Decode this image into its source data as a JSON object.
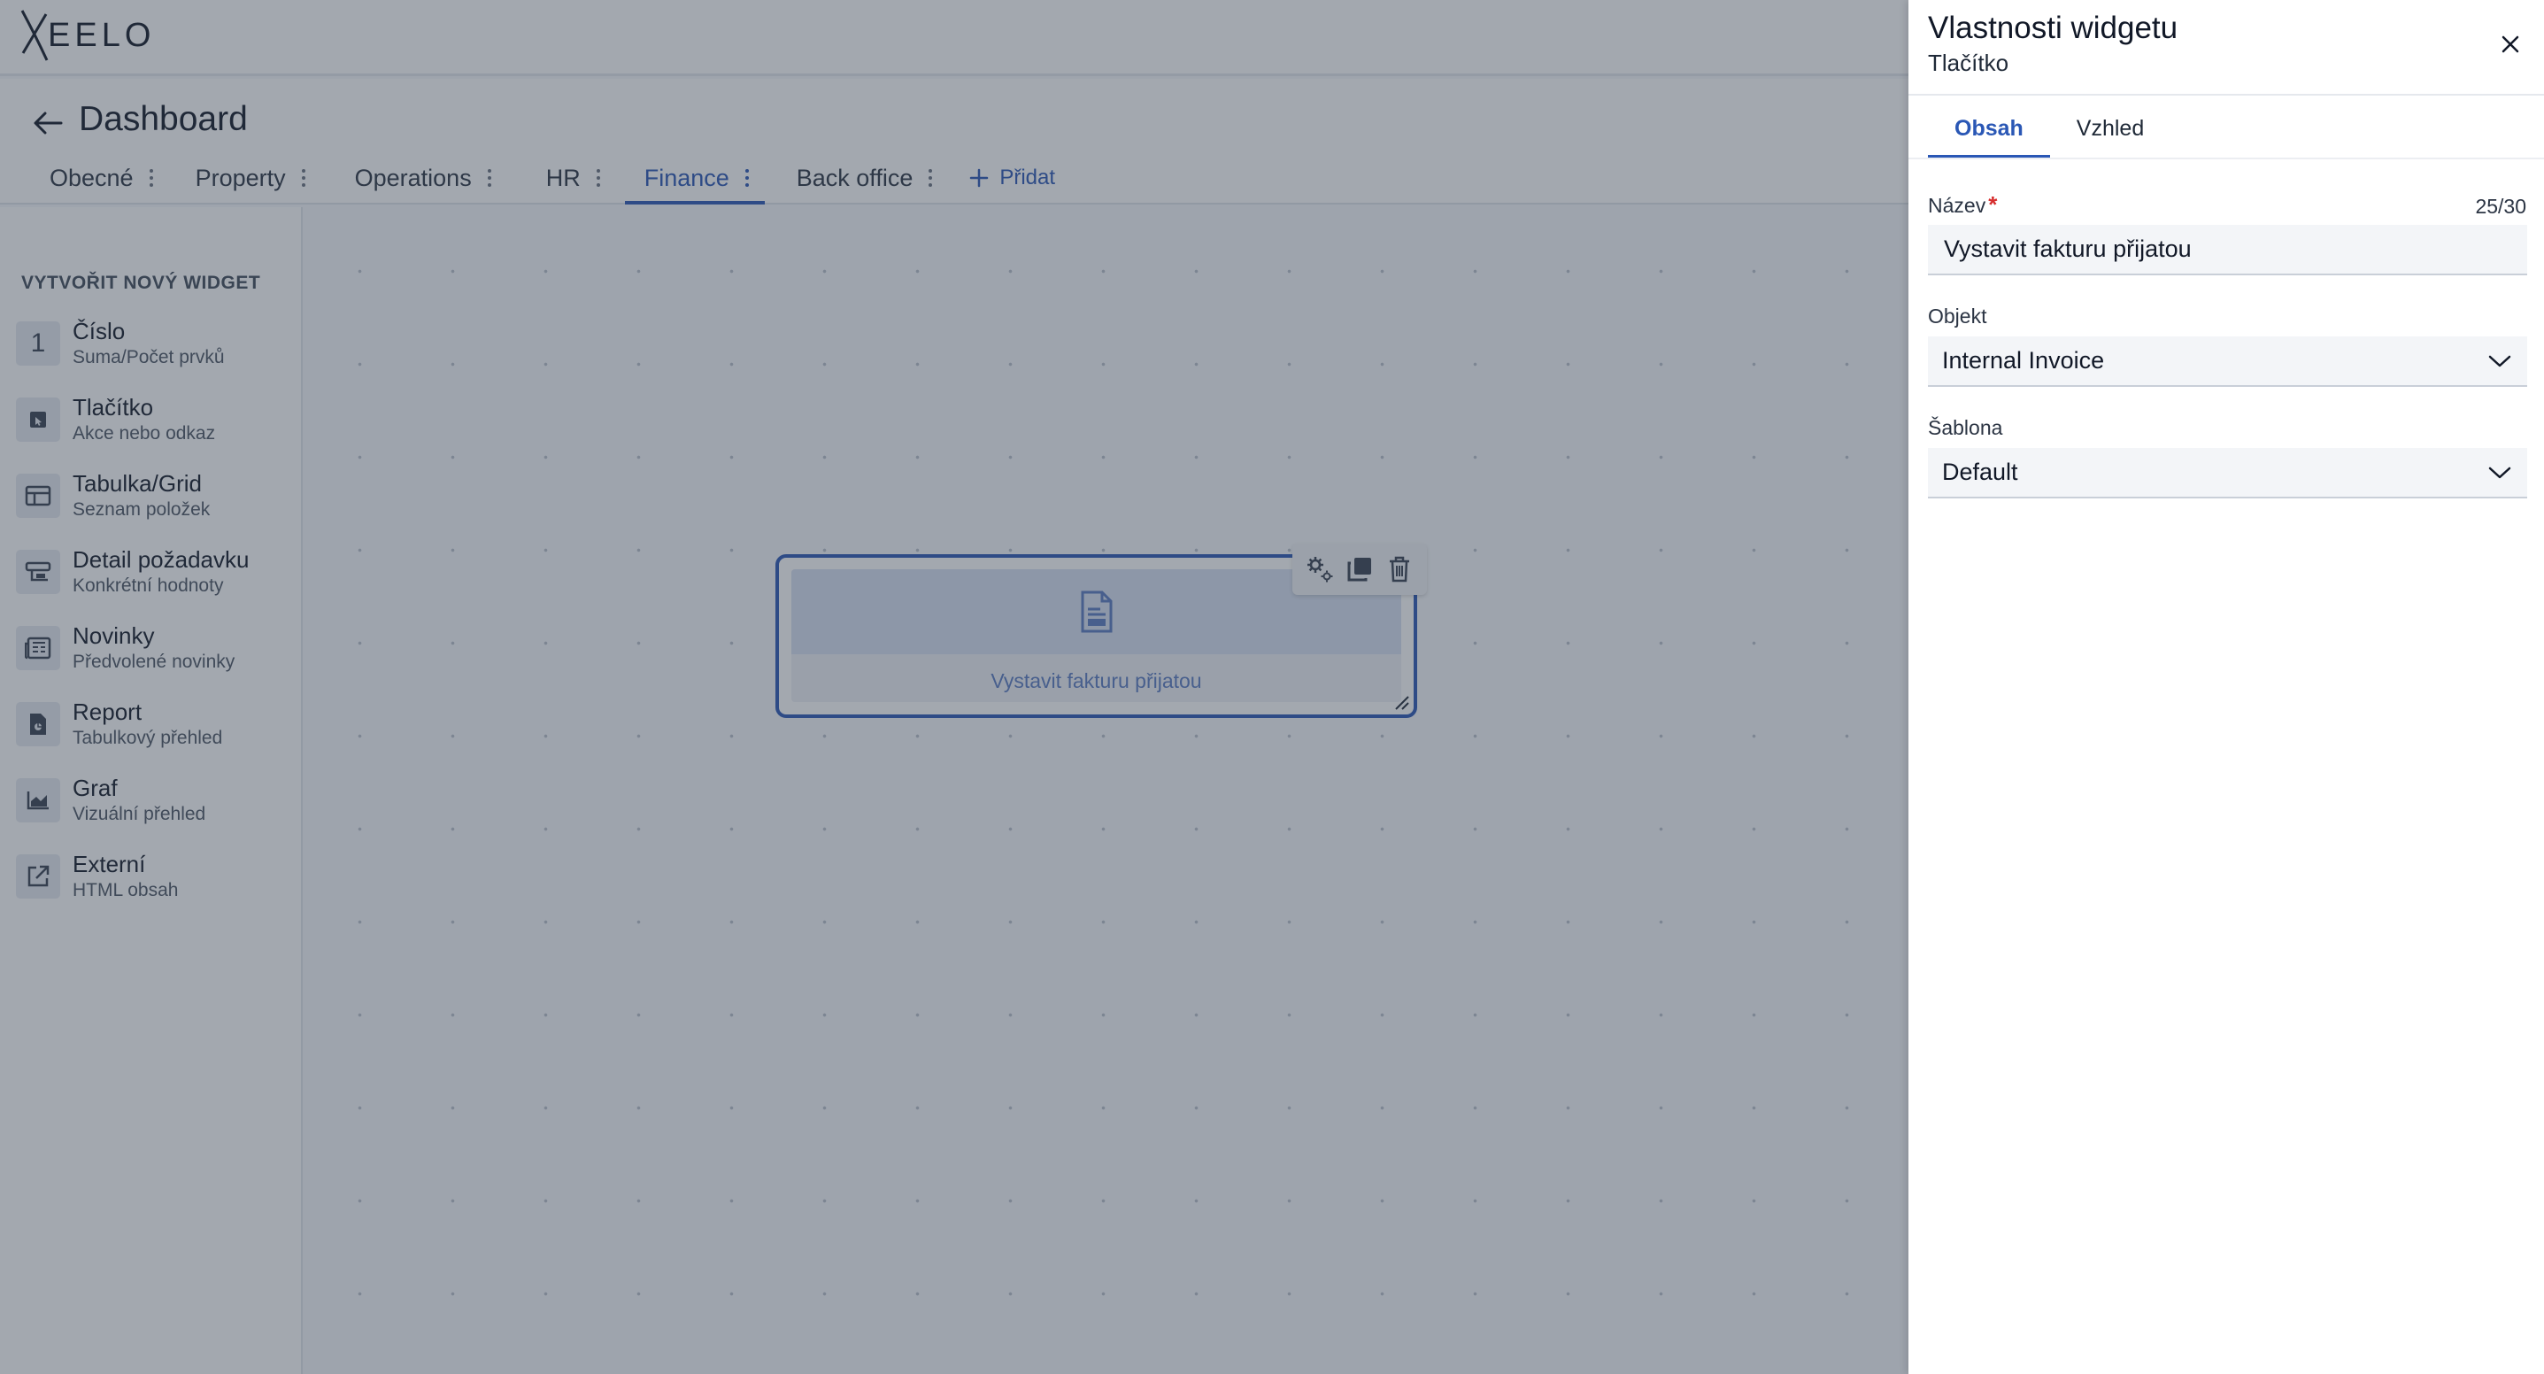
{
  "app": {
    "logo_text": "EELO",
    "page_title": "Dashboard",
    "tabs": [
      {
        "label": "Obecné"
      },
      {
        "label": "Property"
      },
      {
        "label": "Operations"
      },
      {
        "label": "HR"
      },
      {
        "label": "Finance"
      },
      {
        "label": "Back office"
      }
    ],
    "active_tab": "Finance",
    "add_tab_label": "Přidat"
  },
  "sidebar": {
    "title": "VYTVOŘIT NOVÝ WIDGET",
    "items": [
      {
        "label": "Číslo",
        "sub": "Suma/Počet prvků",
        "icon": "number-one-icon",
        "glyph": "1"
      },
      {
        "label": "Tlačítko",
        "sub": "Akce nebo odkaz",
        "icon": "button-icon"
      },
      {
        "label": "Tabulka/Grid",
        "sub": "Seznam položek",
        "icon": "table-icon"
      },
      {
        "label": "Detail požadavku",
        "sub": "Konkrétní hodnoty",
        "icon": "detail-card-icon"
      },
      {
        "label": "Novinky",
        "sub": "Předvolené novinky",
        "icon": "newspaper-icon"
      },
      {
        "label": "Report",
        "sub": "Tabulkový přehled",
        "icon": "report-icon"
      },
      {
        "label": "Graf",
        "sub": "Vizuální přehled",
        "icon": "chart-icon"
      },
      {
        "label": "Externí",
        "sub": "HTML obsah",
        "icon": "external-link-icon"
      }
    ]
  },
  "widget": {
    "label": "Vystavit fakturu přijatou",
    "icon": "document-icon"
  },
  "panel": {
    "title": "Vlastnosti widgetu",
    "subtitle": "Tlačítko",
    "tabs": [
      {
        "label": "Obsah"
      },
      {
        "label": "Vzhled"
      }
    ],
    "fields": {
      "name": {
        "label": "Název",
        "required_mark": "*",
        "value": "Vystavit fakturu přijatou",
        "counter": "25/30"
      },
      "object": {
        "label": "Objekt",
        "value": "Internal Invoice"
      },
      "template": {
        "label": "Šablona",
        "value": "Default"
      }
    }
  },
  "colors": {
    "accent": "#2a57b5",
    "overlay": "#343e4e",
    "required": "#d62d2d"
  }
}
